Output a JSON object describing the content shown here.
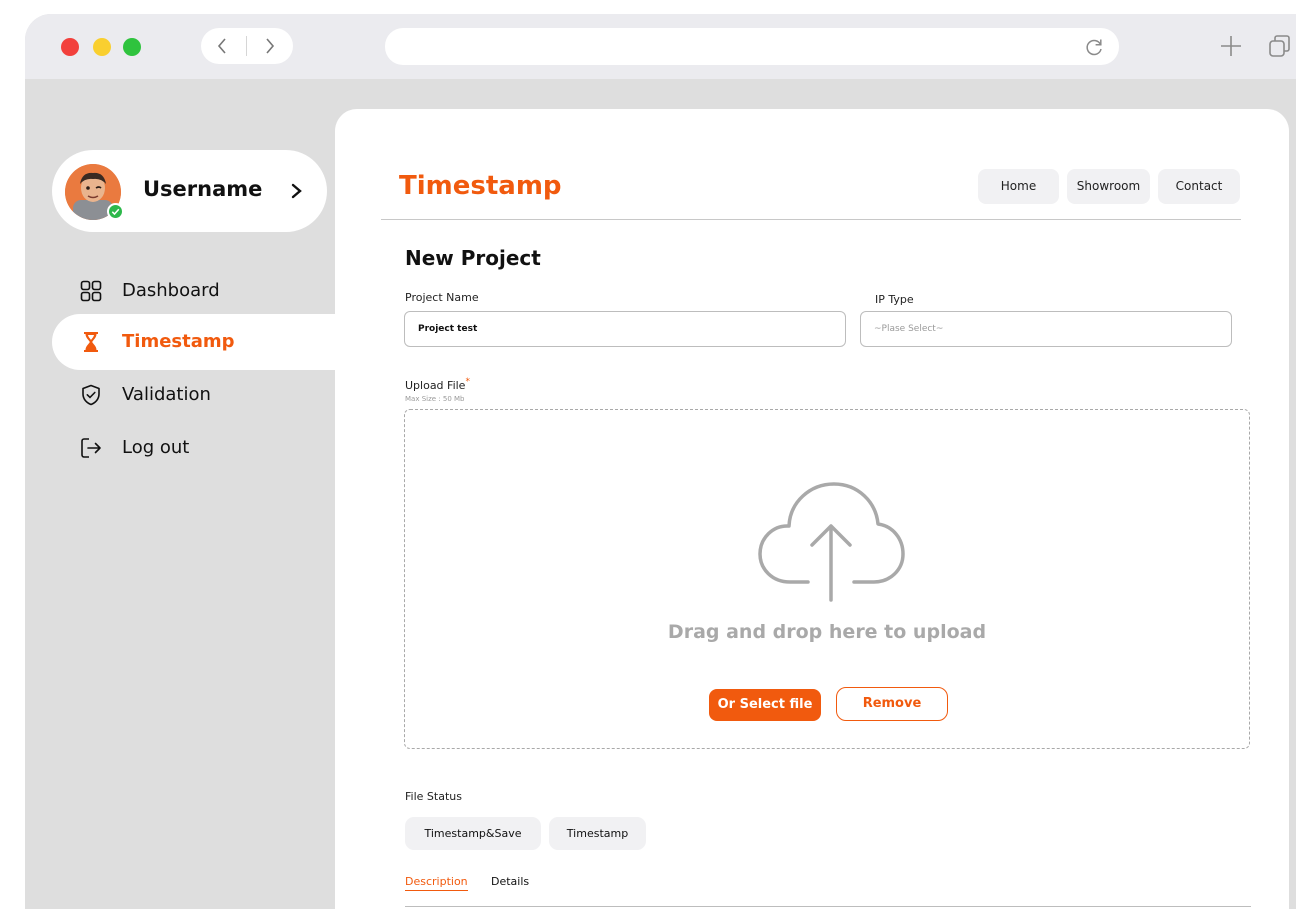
{
  "browser": {
    "controls": [
      "close",
      "minimize",
      "maximize"
    ],
    "url": ""
  },
  "sidebar": {
    "username": "Username",
    "items": [
      {
        "label": "Dashboard",
        "icon": "grid-icon"
      },
      {
        "label": "Timestamp",
        "icon": "hourglass-icon",
        "active": true
      },
      {
        "label": "Validation",
        "icon": "shield-check-icon"
      },
      {
        "label": "Log out",
        "icon": "logout-icon"
      }
    ]
  },
  "header": {
    "brand": "Timestamp",
    "nav": [
      "Home",
      "Showroom",
      "Contact"
    ]
  },
  "form": {
    "title": "New Project",
    "project_name_label": "Project Name",
    "project_name_value": "Project test",
    "ip_type_label": "IP Type",
    "ip_type_placeholder": "~Plase Select~",
    "upload_label": "Upload  File",
    "required_mark": "*",
    "max_size": "Max Size : 50 Mb",
    "drop_text": "Drag and drop here to upload",
    "select_button": "Or Select file",
    "remove_button": "Remove"
  },
  "file_status": {
    "label": "File Status",
    "chips": [
      "Timestamp&Save",
      "Timestamp"
    ],
    "tabs": [
      "Description",
      "Details"
    ]
  },
  "colors": {
    "accent": "#f15a0e",
    "sidebar_bg": "#dedede",
    "status_online": "#2db84b"
  }
}
